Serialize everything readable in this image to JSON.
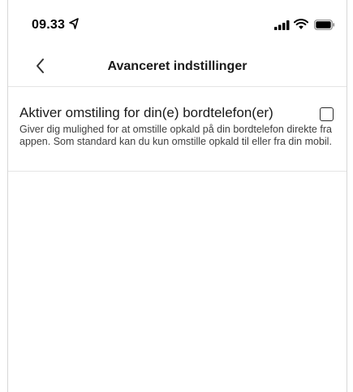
{
  "status_bar": {
    "time": "09.33"
  },
  "nav": {
    "title": "Avanceret indstillinger"
  },
  "setting": {
    "title": "Aktiver omstiling for din(e) bordtelefon(er)",
    "description": "Giver dig mulighed for at omstille opkald på din bordtelefon direkte fra appen. Som standard kan du kun omstille opkald til eller fra din mobil.",
    "checked": false
  }
}
